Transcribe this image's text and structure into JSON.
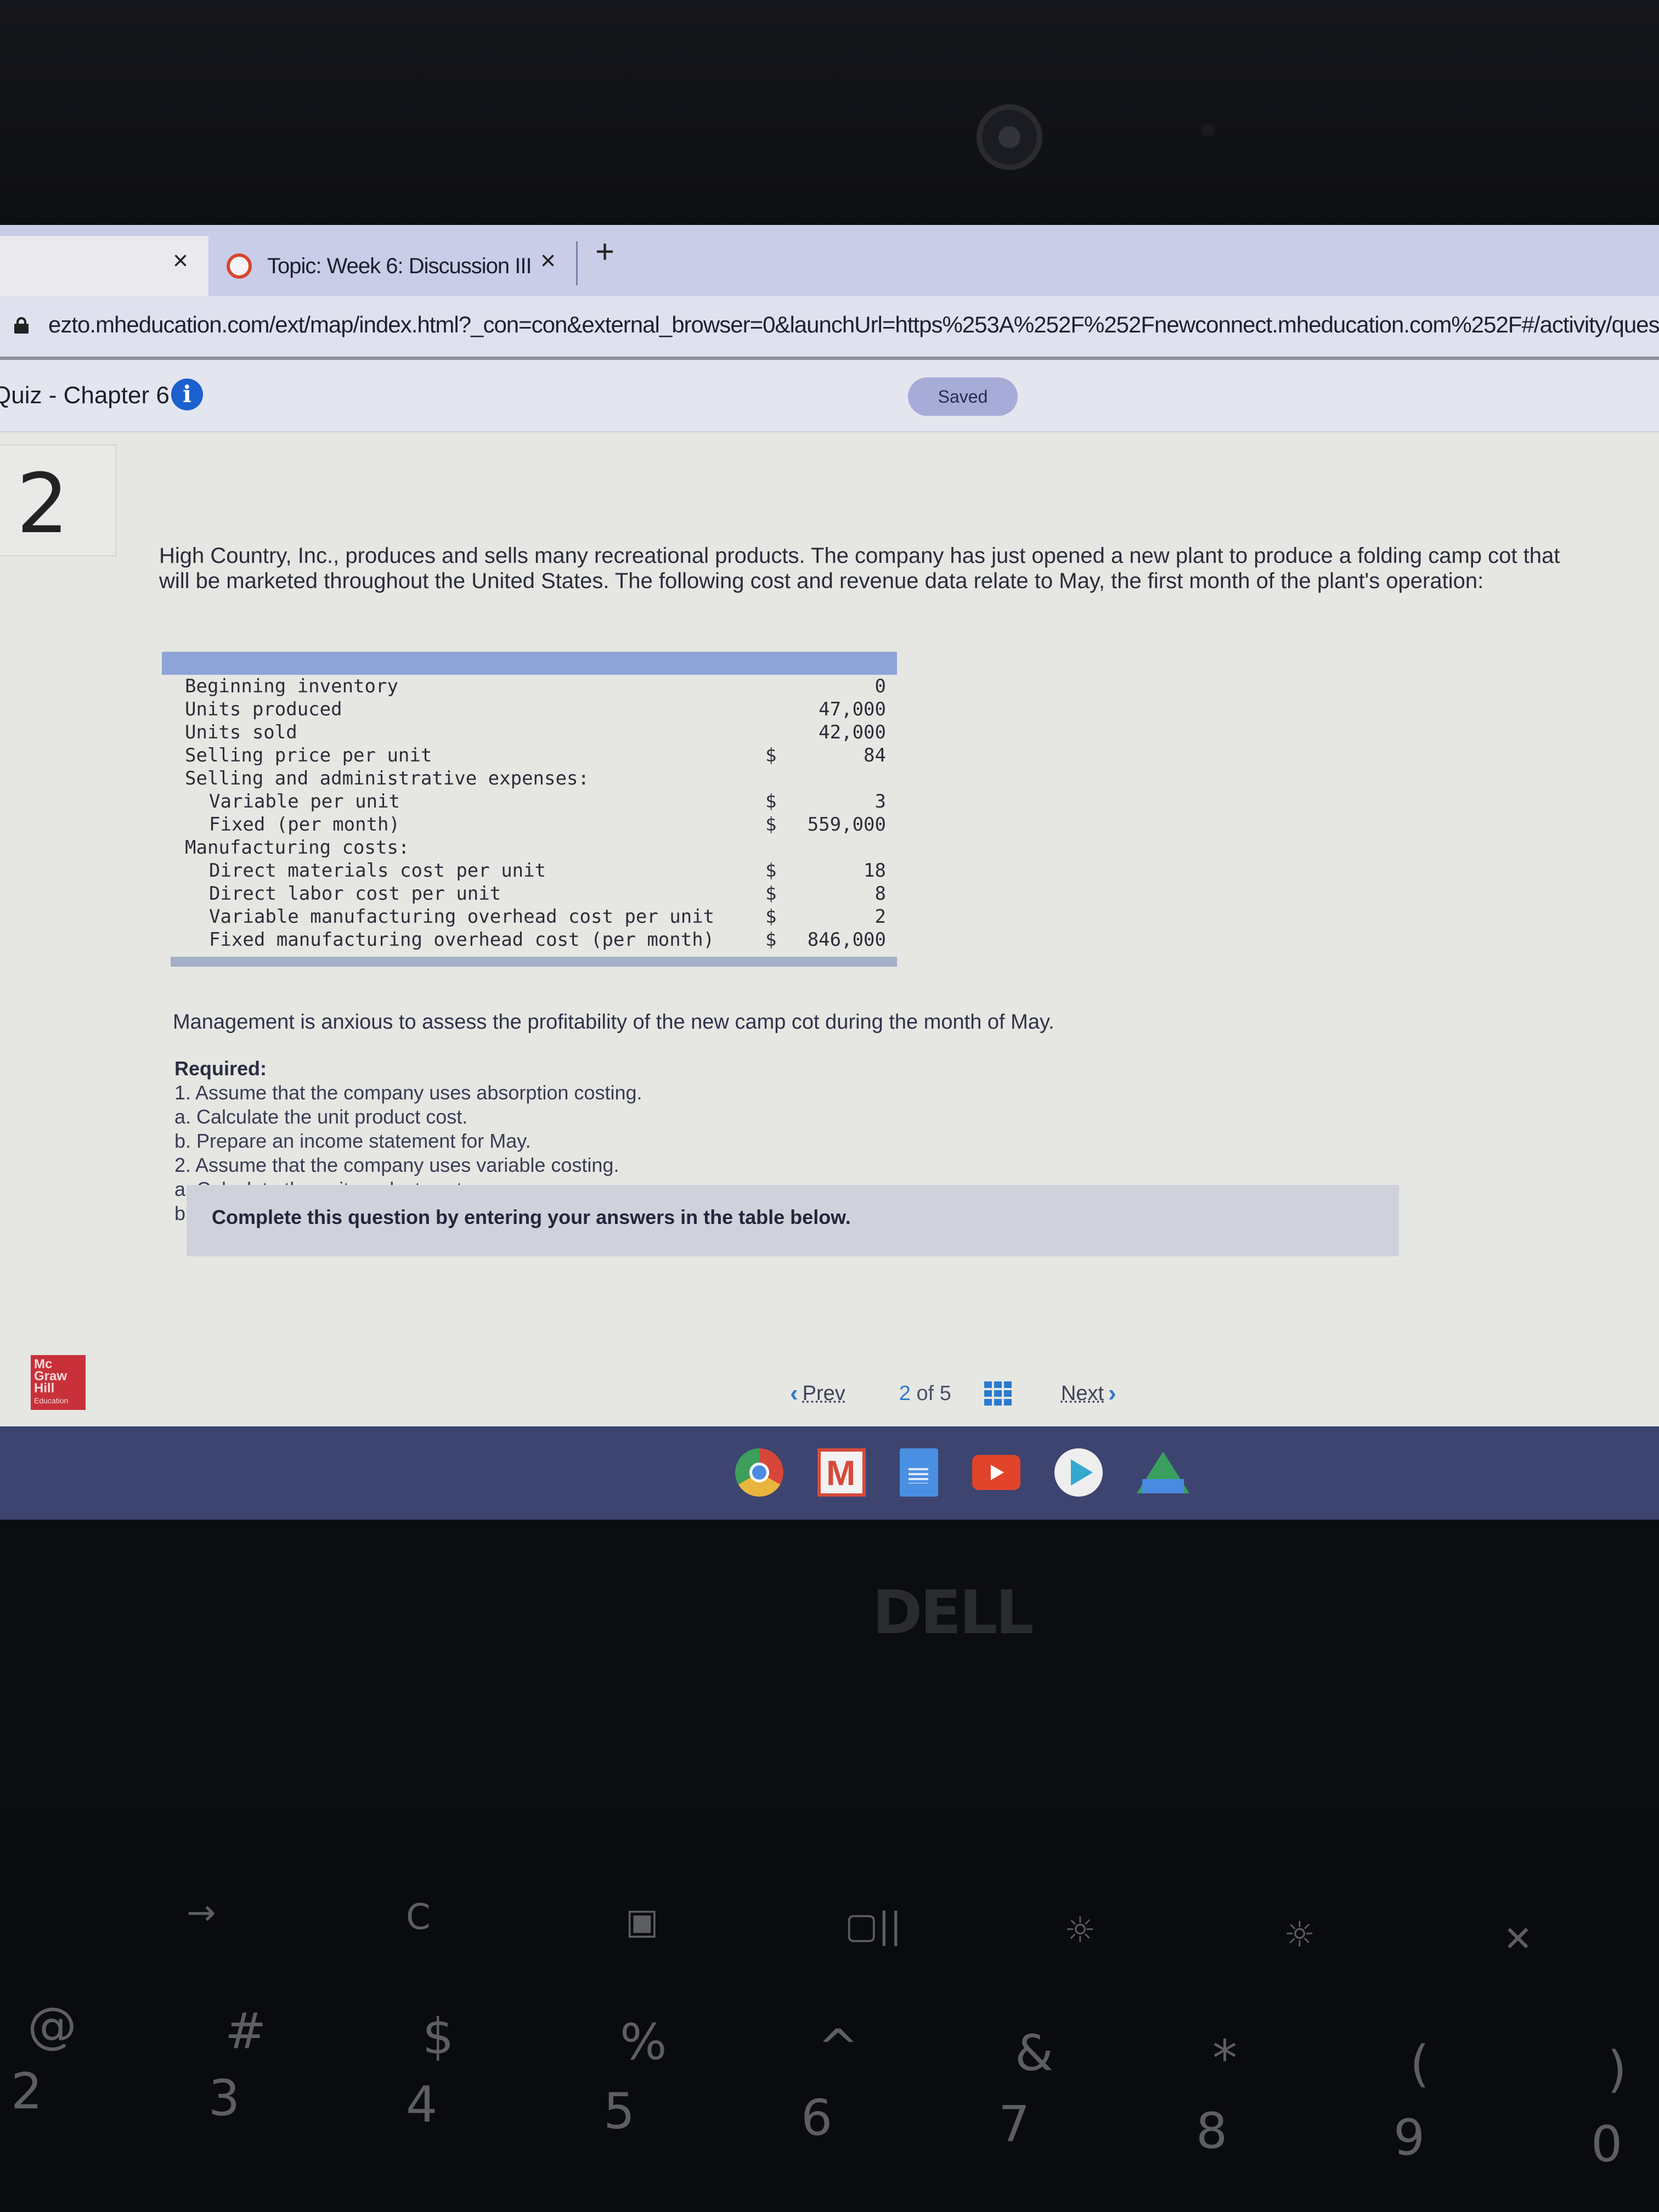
{
  "browser": {
    "tabs": [
      {
        "title": "",
        "close": "×"
      },
      {
        "title": "Topic: Week 6: Discussion III",
        "close": "×",
        "active": true
      }
    ],
    "new_tab": "+",
    "url": "ezto.mheducation.com/ext/map/index.html?_con=con&external_browser=0&launchUrl=https%253A%252F%252Fnewconnect.mheducation.com%252F#/activity/questio"
  },
  "header": {
    "quiz_title": "Quiz - Chapter 6",
    "info_icon": "i",
    "save_status": "Saved"
  },
  "question": {
    "number": "2",
    "intro": "High Country, Inc., produces and sells many recreational products. The company has just opened a new plant to produce a folding camp cot that will be marketed throughout the United States. The following cost and revenue data relate to May, the first month of the plant's operation:",
    "table": [
      {
        "label": "Beginning inventory",
        "currency": "",
        "value": "0",
        "indent": false
      },
      {
        "label": "Units produced",
        "currency": "",
        "value": "47,000",
        "indent": false
      },
      {
        "label": "Units sold",
        "currency": "",
        "value": "42,000",
        "indent": false
      },
      {
        "label": "Selling price per unit",
        "currency": "$",
        "value": "84",
        "indent": false
      },
      {
        "label": "Selling and administrative expenses:",
        "currency": "",
        "value": "",
        "indent": false
      },
      {
        "label": "Variable per unit",
        "currency": "$",
        "value": "3",
        "indent": true
      },
      {
        "label": "Fixed (per month)",
        "currency": "$",
        "value": "559,000",
        "indent": true
      },
      {
        "label": "Manufacturing costs:",
        "currency": "",
        "value": "",
        "indent": false
      },
      {
        "label": "Direct materials cost per unit",
        "currency": "$",
        "value": "18",
        "indent": true
      },
      {
        "label": "Direct labor cost per unit",
        "currency": "$",
        "value": "8",
        "indent": true
      },
      {
        "label": "Variable manufacturing overhead cost per unit",
        "currency": "$",
        "value": "2",
        "indent": true
      },
      {
        "label": "Fixed manufacturing overhead cost (per month)",
        "currency": "$",
        "value": "846,000",
        "indent": true
      }
    ],
    "management": "Management is anxious to assess the profitability of the new camp cot during the month of May.",
    "required_title": "Required:",
    "required_items": [
      "1. Assume that the company uses absorption costing.",
      "a. Calculate the unit product cost.",
      "b. Prepare an income statement for May.",
      "2. Assume that the company uses variable costing.",
      "a. Calculate the unit product cost.",
      "b. Prepare a contribution format income statement for May."
    ],
    "instruction": "Complete this question by entering your answers in the table below."
  },
  "footer": {
    "logo_lines": [
      "Mc",
      "Graw",
      "Hill",
      "Education"
    ],
    "prev_label": "Prev",
    "current_page": "2",
    "of_label": "of",
    "total_pages": "5",
    "next_label": "Next"
  },
  "shelf": {
    "apps": [
      "chrome-icon",
      "gmail-icon",
      "docs-icon",
      "youtube-icon",
      "play-store-icon",
      "drive-icon"
    ]
  },
  "hardware": {
    "brand": "DELL",
    "keys_top": [
      "→",
      "C",
      "▣",
      "▢||",
      "☼",
      "☼",
      "✕"
    ],
    "keys_symbols": [
      "@",
      "#",
      "$",
      "%",
      "^",
      "&",
      "*",
      "(",
      ")"
    ],
    "keys_numbers": [
      "2",
      "3",
      "4",
      "5",
      "6",
      "7",
      "8",
      "9",
      "0"
    ]
  }
}
